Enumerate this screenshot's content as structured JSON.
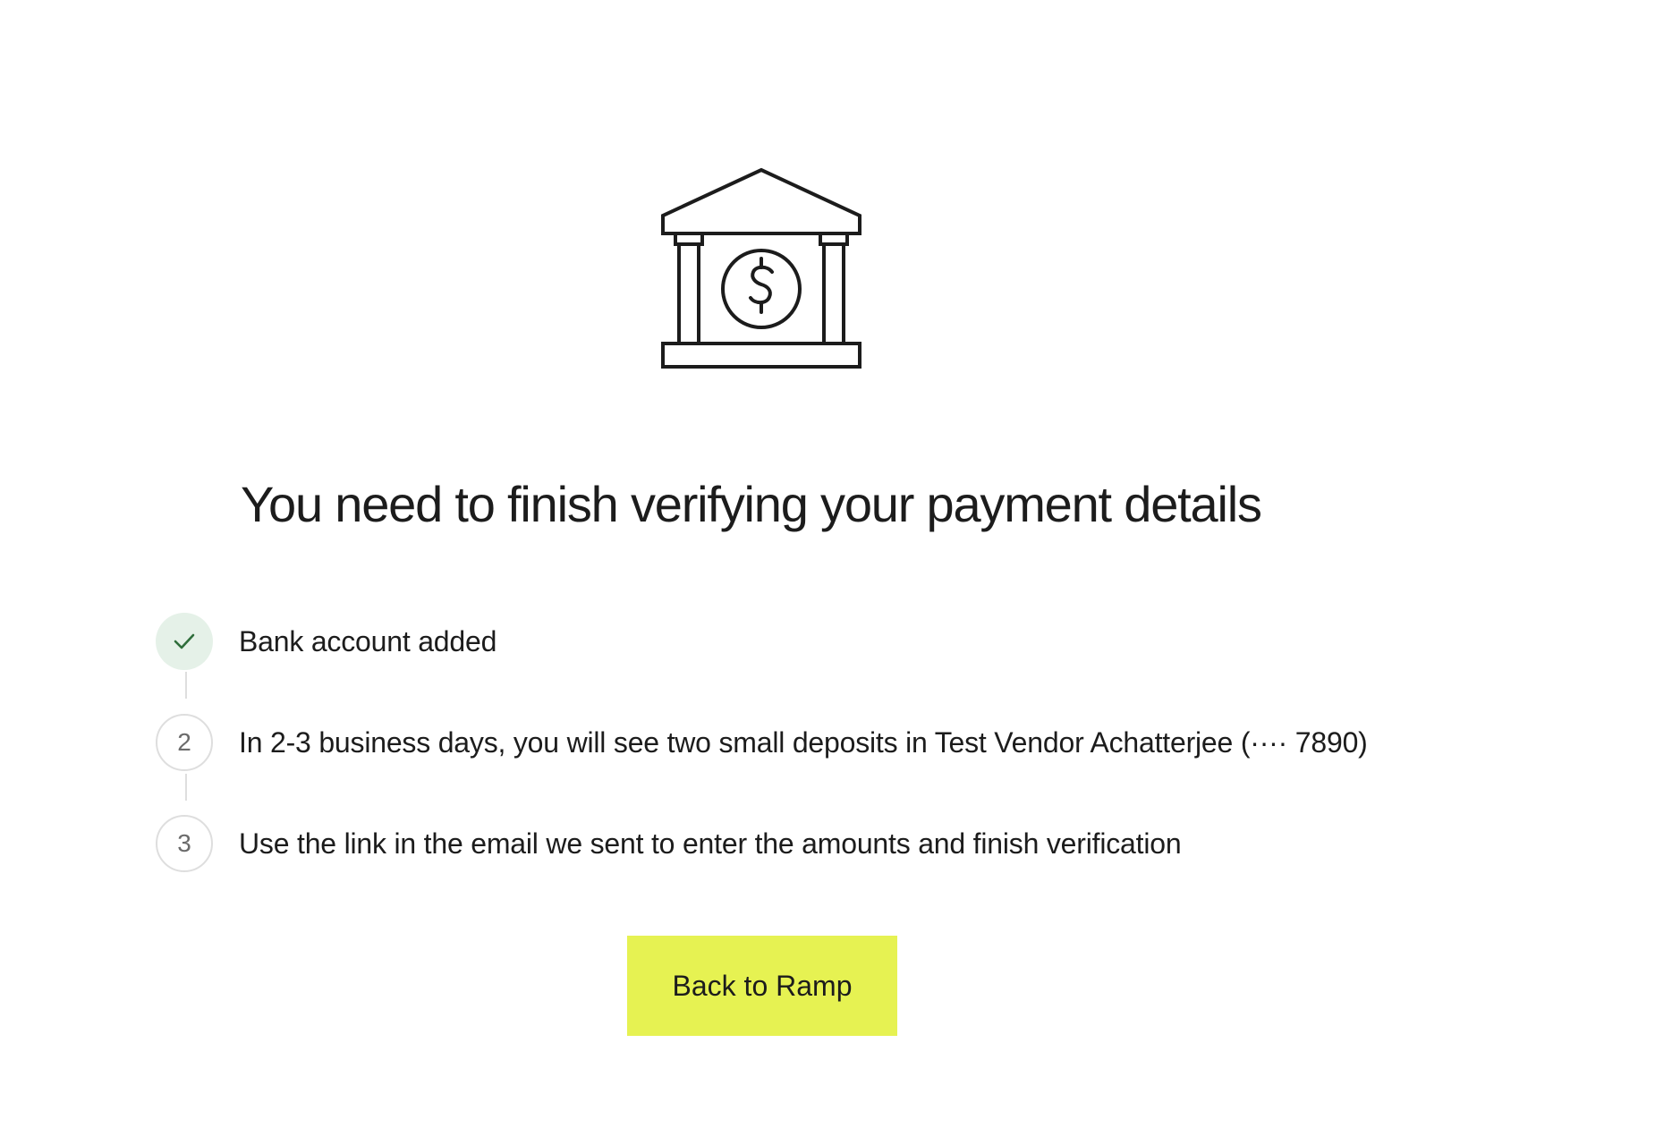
{
  "icons": {
    "illustration": "bank-dollar-icon",
    "completed_step": "check-icon"
  },
  "colors": {
    "accent": "#e6f252",
    "done_badge": "#e5f1e8",
    "check": "#2f6e3b",
    "text": "#1c1c1c",
    "muted": "#6b6b6b",
    "border": "#dedede"
  },
  "title": "You need to finish verifying your payment details",
  "steps": [
    {
      "status": "completed",
      "marker": "",
      "text": "Bank account added"
    },
    {
      "status": "pending",
      "marker": "2",
      "text": "In 2-3 business days, you will see two small deposits in Test Vendor Achatterjee (···· 7890)"
    },
    {
      "status": "pending",
      "marker": "3",
      "text": "Use the link in the email we sent to enter the amounts and finish verification"
    }
  ],
  "actions": {
    "back_label": "Back to Ramp"
  }
}
